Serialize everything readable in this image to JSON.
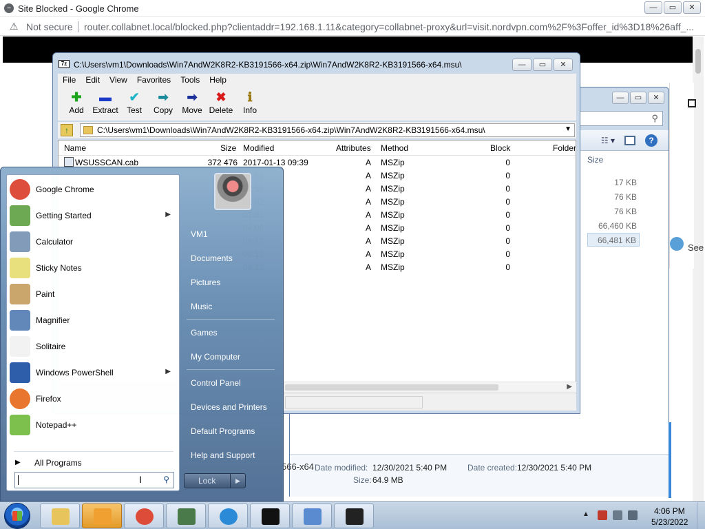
{
  "chrome": {
    "title": "Site Blocked - Google Chrome",
    "security_label": "Not secure",
    "url": "router.collabnet.local/blocked.php?clientaddr=192.168.1.11&category=collabnet-proxy&url=visit.nordvpn.com%2F%3Foffer_id%3D18%26aff_...",
    "window_buttons": [
      "—",
      "▭",
      "✕"
    ],
    "see_text": "See"
  },
  "sevenzip": {
    "icon_text": "7z",
    "title": "C:\\Users\\vm1\\Downloads\\Win7AndW2K8R2-KB3191566-x64.zip\\Win7AndW2K8R2-KB3191566-x64.msu\\",
    "window_buttons": [
      "—",
      "▭",
      "✕"
    ],
    "menu": [
      "File",
      "Edit",
      "View",
      "Favorites",
      "Tools",
      "Help"
    ],
    "toolbar": [
      {
        "label": "Add",
        "icon": "plus-icon",
        "glyph": "✚",
        "color": "#1aa51a"
      },
      {
        "label": "Extract",
        "icon": "minus-icon",
        "glyph": "▬",
        "color": "#1a3cc8"
      },
      {
        "label": "Test",
        "icon": "check-icon",
        "glyph": "✔",
        "color": "#1fb5c8"
      },
      {
        "label": "Copy",
        "icon": "copy-arrow-icon",
        "glyph": "➡",
        "color": "#1b8a9a"
      },
      {
        "label": "Move",
        "icon": "move-arrow-icon",
        "glyph": "➡",
        "color": "#1a2f9a"
      },
      {
        "label": "Delete",
        "icon": "delete-x-icon",
        "glyph": "✖",
        "color": "#d81a1a"
      },
      {
        "label": "Info",
        "icon": "info-icon",
        "glyph": "ℹ",
        "color": "#9a7a10"
      }
    ],
    "path": "C:\\Users\\vm1\\Downloads\\Win7AndW2K8R2-KB3191566-x64.zip\\Win7AndW2K8R2-KB3191566-x64.msu\\",
    "columns": [
      "Name",
      "Size",
      "Modified",
      "Attributes",
      "Method",
      "Block",
      "Folder"
    ],
    "rows": [
      {
        "name": "WSUSSCAN.cab",
        "size": "372 476",
        "modified": "2017-01-13 09:39",
        "attr": "A",
        "method": "MSZip",
        "block": "0"
      },
      {
        "name": "",
        "size": "",
        "modified": "03:52",
        "attr": "A",
        "method": "MSZip",
        "block": "0"
      },
      {
        "name": "",
        "size": "",
        "modified": "22:56",
        "attr": "A",
        "method": "MSZip",
        "block": "0"
      },
      {
        "name": "",
        "size": "",
        "modified": "01:02",
        "attr": "A",
        "method": "MSZip",
        "block": "0"
      },
      {
        "name": "",
        "size": "",
        "modified": "01:02",
        "attr": "A",
        "method": "MSZip",
        "block": "0"
      },
      {
        "name": "",
        "size": "",
        "modified": "04:06",
        "attr": "A",
        "method": "MSZip",
        "block": "0"
      },
      {
        "name": "",
        "size": "",
        "modified": "08:12",
        "attr": "A",
        "method": "MSZip",
        "block": "0"
      },
      {
        "name": "",
        "size": "",
        "modified": "08:12",
        "attr": "A",
        "method": "MSZip",
        "block": "0"
      },
      {
        "name": "",
        "size": "",
        "modified": "08:12",
        "attr": "A",
        "method": "MSZip",
        "block": "0"
      }
    ]
  },
  "explorer": {
    "window_buttons": [
      "—",
      "▭",
      "✕"
    ],
    "size_header": "Size",
    "sizes": [
      "17 KB",
      "76 KB",
      "76 KB",
      "66,460 KB",
      "66,481 KB"
    ],
    "details": {
      "filename_fragment": "566-x64",
      "date_modified_label": "Date modified:",
      "date_modified": "12/30/2021 5:40 PM",
      "date_created_label": "Date created:",
      "date_created": "12/30/2021 5:40 PM",
      "size_label": "Size:",
      "size": "64.9 MB"
    }
  },
  "start_menu": {
    "programs": [
      {
        "label": "Google Chrome",
        "icon": "chrome-icon",
        "color": "#dd4b39",
        "submenu": false
      },
      {
        "label": "Getting Started",
        "icon": "getting-started-icon",
        "color": "#6aa84f",
        "submenu": true
      },
      {
        "label": "Calculator",
        "icon": "calculator-icon",
        "color": "#7f9ab8",
        "submenu": false
      },
      {
        "label": "Sticky Notes",
        "icon": "sticky-notes-icon",
        "color": "#e8e07a",
        "submenu": false
      },
      {
        "label": "Paint",
        "icon": "paint-icon",
        "color": "#c9a46a",
        "submenu": false
      },
      {
        "label": "Magnifier",
        "icon": "magnifier-icon",
        "color": "#5e86b8",
        "submenu": false
      },
      {
        "label": "Solitaire",
        "icon": "solitaire-icon",
        "color": "#f2f2f2",
        "submenu": false
      },
      {
        "label": "Windows PowerShell",
        "icon": "powershell-icon",
        "color": "#2a5aa8",
        "submenu": true
      },
      {
        "label": "Firefox",
        "icon": "firefox-icon",
        "color": "#e8742a",
        "submenu": false
      },
      {
        "label": "Notepad++",
        "icon": "notepadpp-icon",
        "color": "#7cbf4a",
        "submenu": false
      }
    ],
    "all_programs": "All Programs",
    "search_placeholder": "",
    "right_links": [
      "VM1",
      "Documents",
      "Pictures",
      "Music",
      "Games",
      "My Computer",
      "Control Panel",
      "Devices and Printers",
      "Default Programs",
      "Help and Support"
    ],
    "lock_label": "Lock"
  },
  "taskbar": {
    "apps": [
      {
        "name": "explorer",
        "icon": "folder-icon",
        "color": "#e8c55c"
      },
      {
        "name": "media-player",
        "icon": "media-player-icon",
        "color": "#f0a030"
      },
      {
        "name": "chrome",
        "icon": "chrome-icon",
        "color": "#dd4b39"
      },
      {
        "name": "task-manager",
        "icon": "monitor-icon",
        "color": "#4a7a4a"
      },
      {
        "name": "internet-explorer",
        "icon": "ie-icon",
        "color": "#2a8ad8"
      },
      {
        "name": "cmd",
        "icon": "cmd-icon",
        "color": "#111111"
      },
      {
        "name": "control-panel",
        "icon": "control-panel-icon",
        "color": "#5a8ad0"
      },
      {
        "name": "7zip",
        "icon": "7zip-icon",
        "color": "#222222"
      }
    ],
    "time": "4:06 PM",
    "date": "5/23/2022"
  }
}
